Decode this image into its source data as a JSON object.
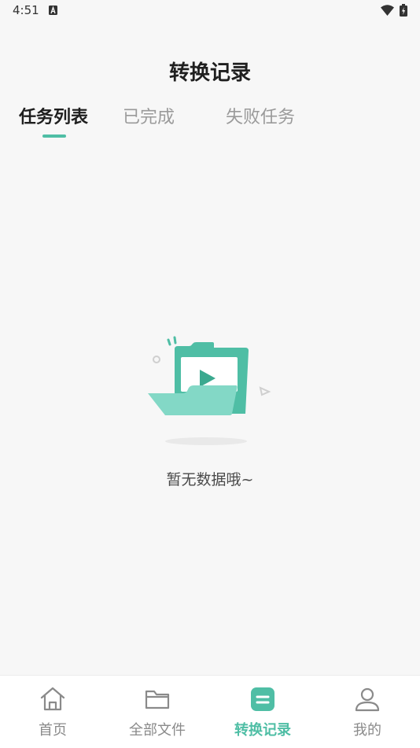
{
  "status_bar": {
    "time": "4:51",
    "icons": [
      "a-icon",
      "wifi-icon",
      "battery-icon"
    ]
  },
  "header": {
    "title": "转换记录"
  },
  "tabs": [
    {
      "label": "任务列表",
      "active": true
    },
    {
      "label": "已完成",
      "active": false
    },
    {
      "label": "失败任务",
      "active": false
    }
  ],
  "empty_state": {
    "icon": "empty-folder-icon",
    "message": "暂无数据哦~"
  },
  "bottom_nav": [
    {
      "label": "首页",
      "icon": "home-icon",
      "active": false
    },
    {
      "label": "全部文件",
      "icon": "folder-icon",
      "active": false
    },
    {
      "label": "转换记录",
      "icon": "records-icon",
      "active": true
    },
    {
      "label": "我的",
      "icon": "user-icon",
      "active": false
    }
  ],
  "colors": {
    "accent": "#4fbea5",
    "background": "#f7f7f7",
    "nav_background": "#ffffff",
    "inactive_text": "#9a9a9a"
  }
}
